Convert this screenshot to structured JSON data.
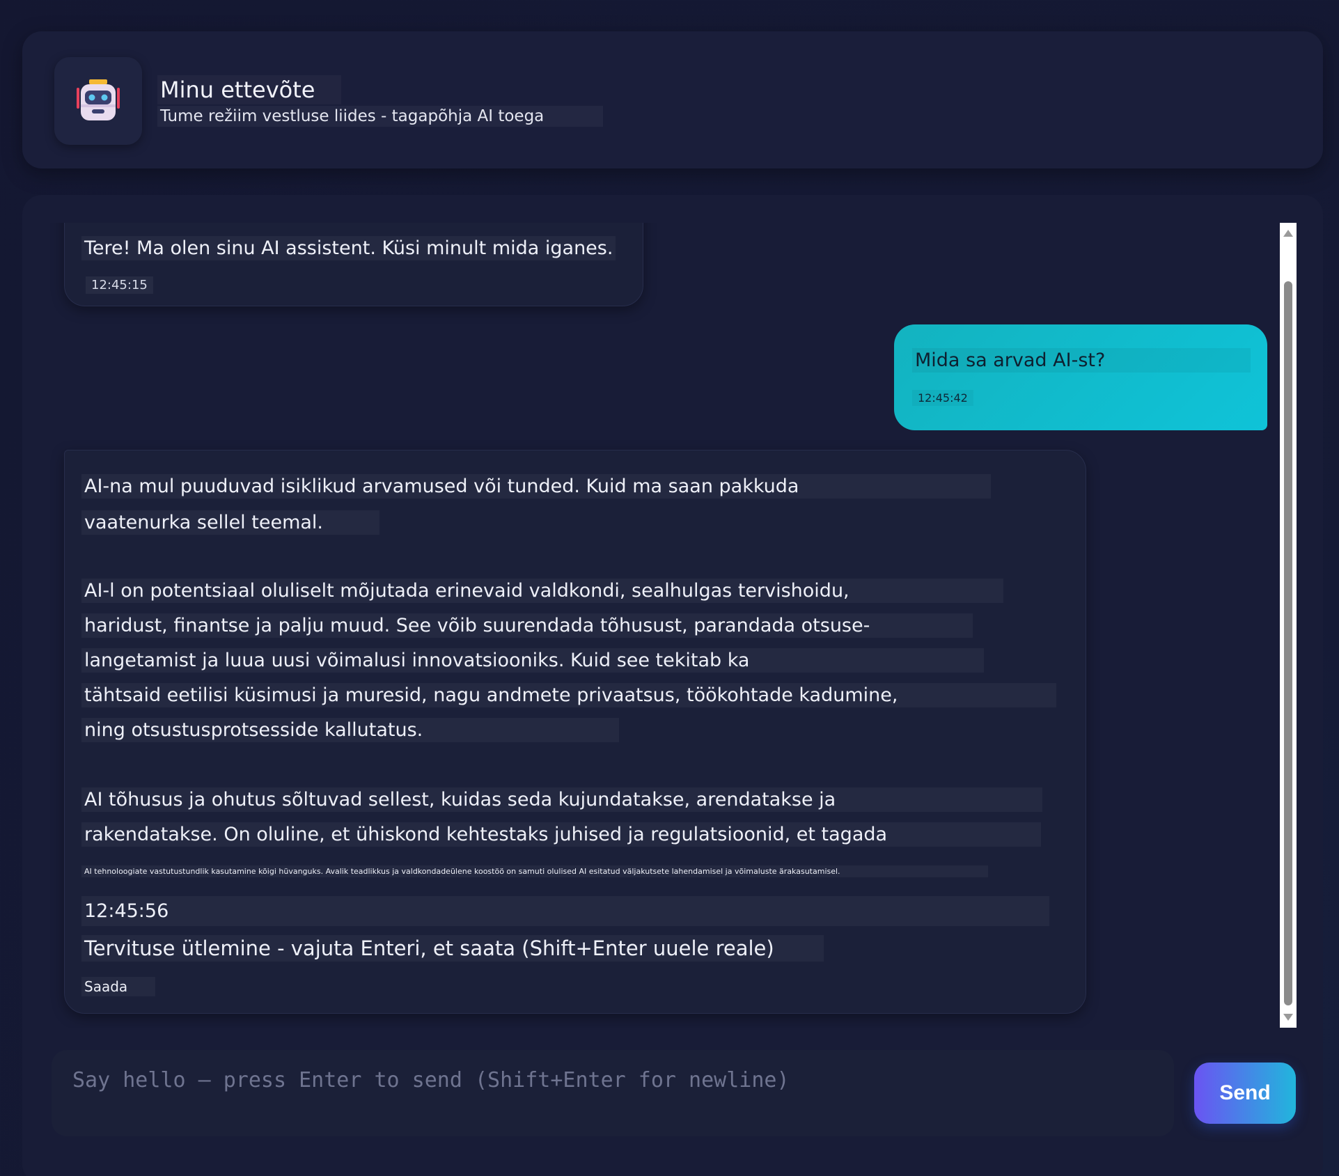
{
  "header": {
    "title": "Minu ettevõte",
    "subtitle": "Tume režiim vestluse liides - tagapõhja AI toega",
    "avatar_icon": "robot-icon"
  },
  "messages": [
    {
      "role": "bot",
      "text": "Tere! Ma olen sinu AI assistent. Küsi minult mida iganes.",
      "time": "12:45:15"
    },
    {
      "role": "user",
      "text": "Mida sa arvad AI-st?",
      "time": "12:45:42"
    },
    {
      "role": "bot",
      "lines": [
        "AI-na mul puuduvad isiklikud arvamused või tunded. Kuid ma saan pakkuda",
        "vaatenurka sellel teemal.",
        "AI-l on potentsiaal oluliselt mõjutada erinevaid valdkondi, sealhulgas tervishoidu,",
        "haridust, finantse ja palju muud. See võib suurendada tõhusust, parandada otsuse-",
        "langetamist ja luua uusi võimalusi innovatsiooniks. Kuid see tekitab ka",
        "tähtsaid eetilisi küsimusi ja muresid, nagu andmete privaatsus, töökohtade kadumine,",
        "ning otsustusprotsesside kallutatus.",
        "AI tõhusus ja ohutus sõltuvad sellest, kuidas seda kujundatakse, arendatakse ja",
        "rakendatakse. On oluline, et ühiskond kehtestaks juhised ja regulatsioonid, et tagada",
        "AI tehnoloogiate vastutustundlik kasutamine kõigi hüvanguks. Avalik teadlikkus ja valdkondadeülene koostöö on samuti olulised AI esitatud väljakutsete lahendamisel ja võimaluste ärakasutamisel."
      ],
      "time": "12:45:56",
      "hint": "Tervituse ütlemine - vajuta Enteri, et saata (Shift+Enter uuele reale)",
      "action": "Saada"
    }
  ],
  "composer": {
    "placeholder": "Say hello — press Enter to send (Shift+Enter for newline)",
    "send_label": "Send"
  },
  "colors": {
    "background": "#151a35",
    "user_bubble": "#0fc3d8",
    "send_gradient_start": "#6a54f2",
    "send_gradient_end": "#21b6dc"
  }
}
